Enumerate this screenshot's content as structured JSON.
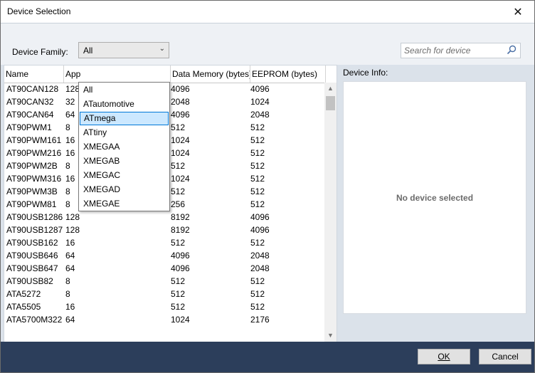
{
  "window": {
    "title": "Device Selection",
    "close_glyph": "✕"
  },
  "toolbar": {
    "family_label": "Device Family:",
    "family_value": "All",
    "search_placeholder": "Search for device"
  },
  "table": {
    "columns": [
      "Name",
      "App",
      "Data Memory (bytes)",
      "EEPROM (bytes)"
    ],
    "rows": [
      [
        "AT90CAN128",
        "128",
        "4096",
        "4096"
      ],
      [
        "AT90CAN32",
        "32",
        "2048",
        "1024"
      ],
      [
        "AT90CAN64",
        "64",
        "4096",
        "2048"
      ],
      [
        "AT90PWM1",
        "8",
        "512",
        "512"
      ],
      [
        "AT90PWM161",
        "16",
        "1024",
        "512"
      ],
      [
        "AT90PWM216",
        "16",
        "1024",
        "512"
      ],
      [
        "AT90PWM2B",
        "8",
        "512",
        "512"
      ],
      [
        "AT90PWM316",
        "16",
        "1024",
        "512"
      ],
      [
        "AT90PWM3B",
        "8",
        "512",
        "512"
      ],
      [
        "AT90PWM81",
        "8",
        "256",
        "512"
      ],
      [
        "AT90USB1286",
        "128",
        "8192",
        "4096"
      ],
      [
        "AT90USB1287",
        "128",
        "8192",
        "4096"
      ],
      [
        "AT90USB162",
        "16",
        "512",
        "512"
      ],
      [
        "AT90USB646",
        "64",
        "4096",
        "2048"
      ],
      [
        "AT90USB647",
        "64",
        "4096",
        "2048"
      ],
      [
        "AT90USB82",
        "8",
        "512",
        "512"
      ],
      [
        "ATA5272",
        "8",
        "512",
        "512"
      ],
      [
        "ATA5505",
        "16",
        "512",
        "512"
      ],
      [
        "ATA5700M322",
        "64",
        "1024",
        "2176"
      ]
    ]
  },
  "dropdown": {
    "options": [
      "All",
      "ATautomotive",
      "ATmega",
      "ATtiny",
      "XMEGAA",
      "XMEGAB",
      "XMEGAC",
      "XMEGAD",
      "XMEGAE"
    ],
    "highlighted": "ATmega"
  },
  "info": {
    "label": "Device Info:",
    "empty_text": "No device selected"
  },
  "footer": {
    "ok_label": "OK",
    "cancel_label": "Cancel"
  },
  "colors": {
    "footer_bg": "#2c3e5b",
    "highlight_bg": "#cce8ff",
    "highlight_border": "#0078d7"
  }
}
